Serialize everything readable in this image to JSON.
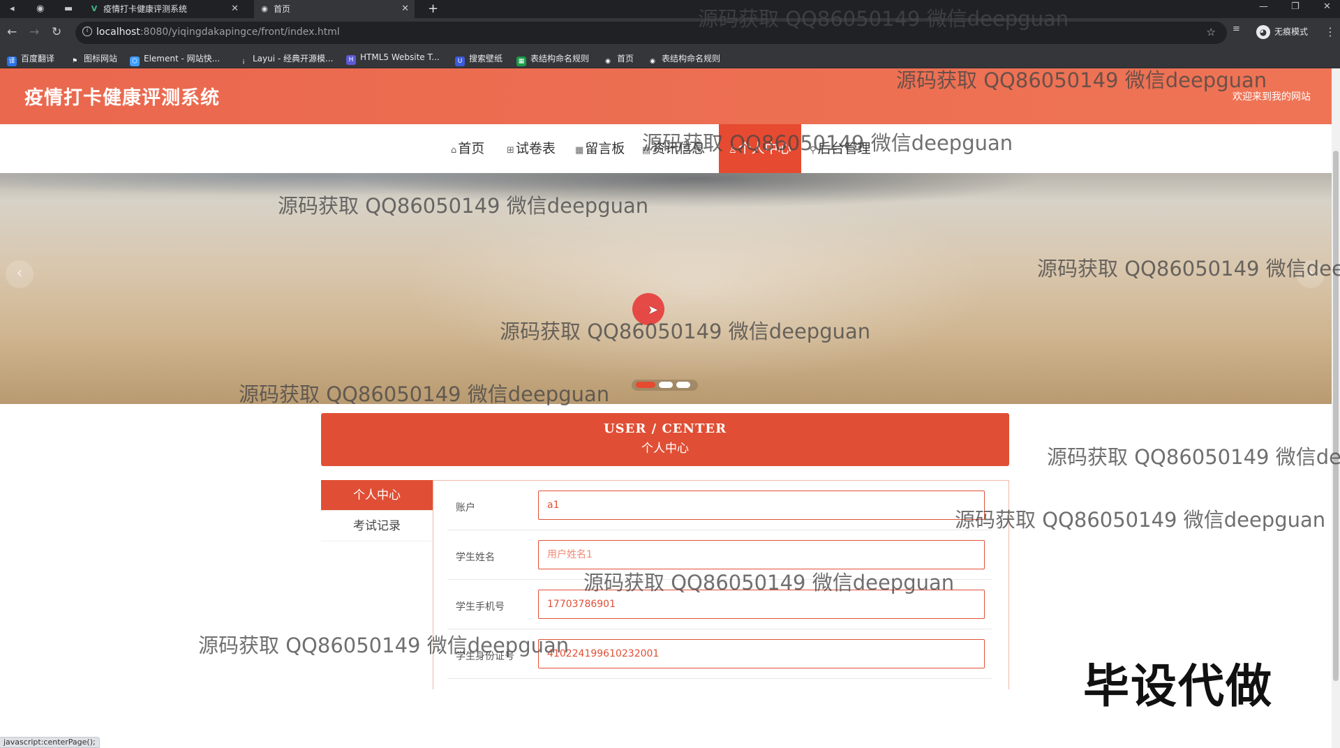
{
  "browser": {
    "tabs": [
      {
        "title": "疫情打卡健康评测系统",
        "icon": "vue-logo-icon"
      },
      {
        "title": "首页",
        "icon": "globe-icon"
      }
    ],
    "new_tab": "+",
    "url_host": "localhost",
    "url_path": ":8080/yiqingdakapingce/front/index.html",
    "profile_label": "无痕模式",
    "bookmarks": [
      "百度翻译",
      "图标网站",
      "Element - 网站快...",
      "Layui - 经典开源模...",
      "HTML5 Website T...",
      "搜索壁纸",
      "表结构命名规则",
      "首页",
      "表结构命名规则"
    ]
  },
  "header": {
    "title": "疫情打卡健康评测系统",
    "welcome": "欢迎来到我的网站"
  },
  "nav": {
    "items": [
      "首页",
      "试卷表",
      "留言板",
      "资讯信息",
      "个人中心",
      "后台管理"
    ],
    "active": "个人中心"
  },
  "banner": {
    "slide_count": 3,
    "active_slide": 1
  },
  "section": {
    "title_en": "USER / CENTER",
    "title_zh": "个人中心"
  },
  "side_menu": {
    "items": [
      "个人中心",
      "考试记录"
    ],
    "active": "个人中心"
  },
  "form": {
    "fields": [
      {
        "label": "账户",
        "value": "a1",
        "placeholder": ""
      },
      {
        "label": "学生姓名",
        "value": "",
        "placeholder": "用户姓名1"
      },
      {
        "label": "学生手机号",
        "value": "17703786901",
        "placeholder": ""
      },
      {
        "label": "学生身份证号",
        "value": "410224199610232001",
        "placeholder": ""
      }
    ]
  },
  "status_bar": "javascript:centerPage();",
  "overlay": {
    "watermark": "源码获取 QQ86050149 微信deepguan",
    "promo": "毕设代做"
  },
  "colors": {
    "accent": "#e04f35",
    "header_bg": "#ef7455",
    "chrome_dark": "#202124",
    "chrome_mid": "#35363a"
  }
}
